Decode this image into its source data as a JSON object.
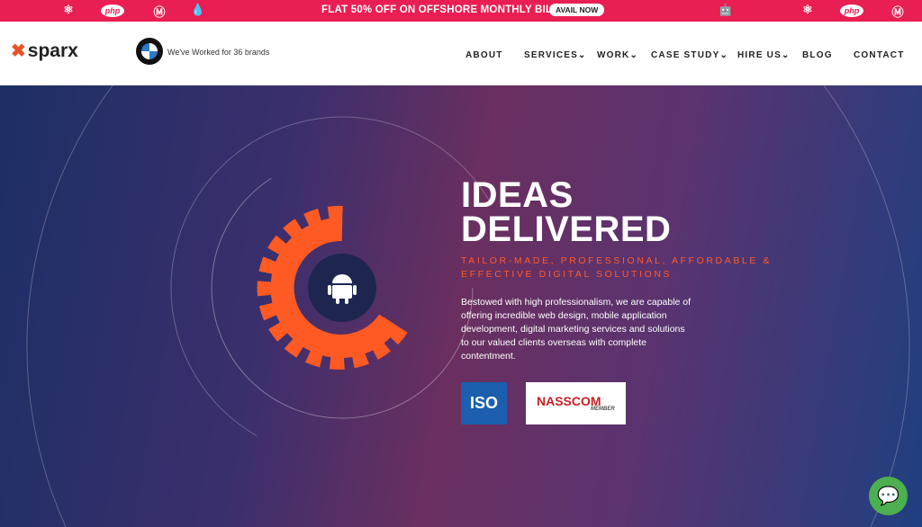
{
  "promo": {
    "message": "FLAT 50% OFF ON OFFSHORE MONTHLY BILLING",
    "cta": "AVAIL NOW",
    "accent": "#e91e52",
    "left_icons": [
      "apple-icon",
      "react-icon",
      "php-icon",
      "magento-icon",
      "drupal-icon"
    ],
    "right_icons": [
      "android-icon",
      "apple-icon",
      "react-icon",
      "php-icon",
      "magento-icon"
    ],
    "php_label": "php"
  },
  "header": {
    "logo": "sparx",
    "brands_text": "We've Worked for 36 brands",
    "nav": [
      {
        "label": "ABOUT"
      },
      {
        "label": "SERVICES",
        "dropdown": "⌄"
      },
      {
        "label": "WORK",
        "dropdown": "⌄"
      },
      {
        "label": "CASE STUDY",
        "dropdown": "⌄"
      },
      {
        "label": "HIRE US",
        "dropdown": "⌄"
      },
      {
        "label": "BLOG"
      },
      {
        "label": "CONTACT"
      }
    ]
  },
  "hero": {
    "title_line1": "IDEAS",
    "title_line2": "DELIVERED",
    "subtitle_line1": "TAILOR-MADE, PROFESSIONAL, AFFORDABLE &",
    "subtitle_line2": "EFFECTIVE DIGITAL SOLUTIONS",
    "description": "Bestowed with high professionalism, we are capable of offering incredible web design, mobile application development, digital marketing services and solutions to our valued clients overseas with complete contentment.",
    "badges": {
      "iso": "ISO",
      "nasscom": "NASSCOM",
      "nasscom_sub": "MEMBER"
    },
    "accent": "#ff5a2a"
  },
  "chat": {
    "icon": "chat-icon"
  }
}
